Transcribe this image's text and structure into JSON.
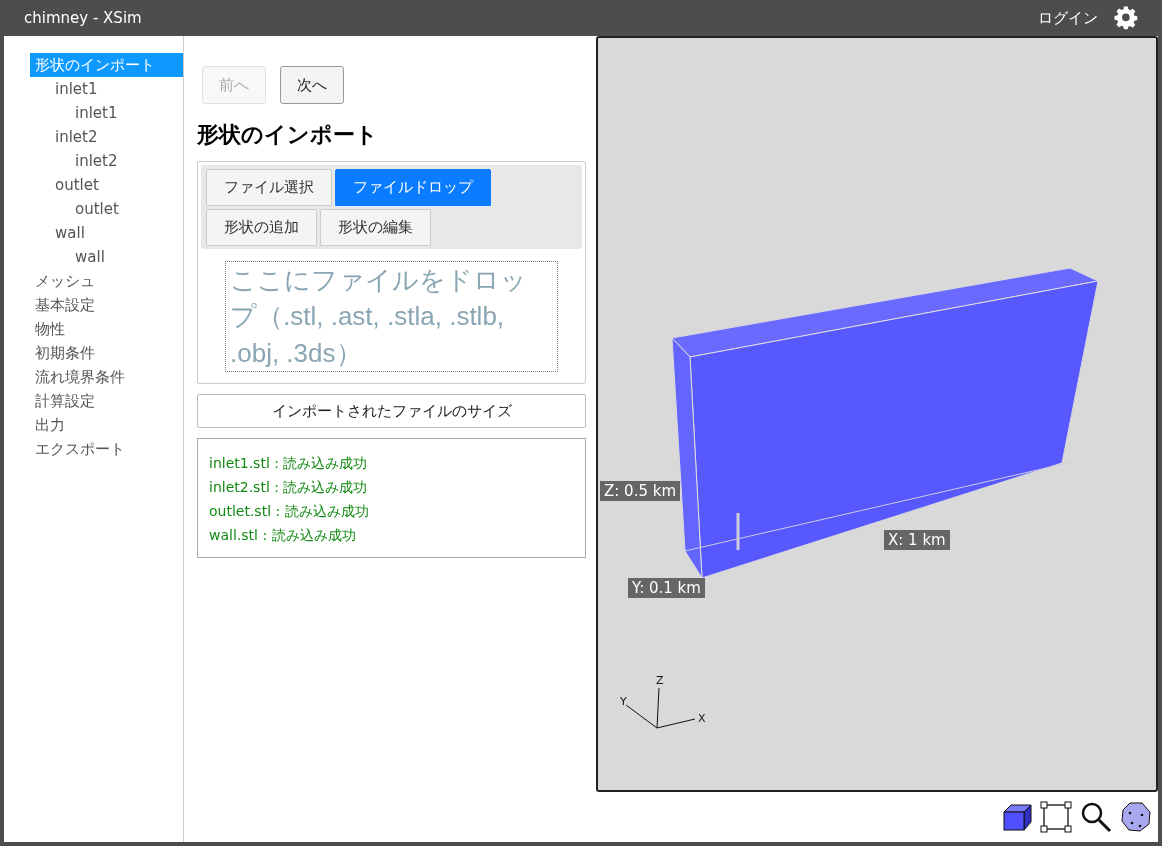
{
  "window": {
    "title": "chimney - XSim",
    "login": "ログイン"
  },
  "sidebar": {
    "items": [
      {
        "label": "形状のインポート",
        "selected": true,
        "children": [
          {
            "label": "inlet1",
            "selected": false,
            "children": [
              {
                "label": "inlet1",
                "selected": false
              }
            ]
          },
          {
            "label": "inlet2",
            "selected": false,
            "children": [
              {
                "label": "inlet2",
                "selected": false
              }
            ]
          },
          {
            "label": "outlet",
            "selected": false,
            "children": [
              {
                "label": "outlet",
                "selected": false
              }
            ]
          },
          {
            "label": "wall",
            "selected": false,
            "children": [
              {
                "label": "wall",
                "selected": false
              }
            ]
          }
        ]
      },
      {
        "label": "メッシュ",
        "selected": false
      },
      {
        "label": "基本設定",
        "selected": false
      },
      {
        "label": "物性",
        "selected": false
      },
      {
        "label": "初期条件",
        "selected": false
      },
      {
        "label": "流れ境界条件",
        "selected": false
      },
      {
        "label": "計算設定",
        "selected": false
      },
      {
        "label": "出力",
        "selected": false
      },
      {
        "label": "エクスポート",
        "selected": false
      }
    ]
  },
  "nav": [
    {
      "label": "前へ",
      "disabled": true
    },
    {
      "label": "次へ",
      "disabled": false
    }
  ],
  "heading": "形状のインポート",
  "tabs": [
    {
      "label": "ファイル選択",
      "selected": false
    },
    {
      "label": "ファイルドロップ",
      "selected": true
    },
    {
      "label": "形状の追加",
      "selected": false
    },
    {
      "label": "形状の編集",
      "selected": false
    }
  ],
  "drop_zone": "ここにファイルをドロップ（.stl, .ast, .stla, .stlb, .obj, .3ds）",
  "size_button": "インポートされたファイルのサイズ",
  "log": [
    "inlet1.stl : 読み込み成功",
    "inlet2.stl : 読み込み成功",
    "outlet.stl : 読み込み成功",
    "wall.stl : 読み込み成功"
  ],
  "viewport": {
    "z_label": "Z: 0.5 km",
    "x_label": "X: 1 km",
    "y_label": "Y: 0.1 km",
    "axes": {
      "x": "X",
      "y": "Y",
      "z": "Z"
    }
  }
}
